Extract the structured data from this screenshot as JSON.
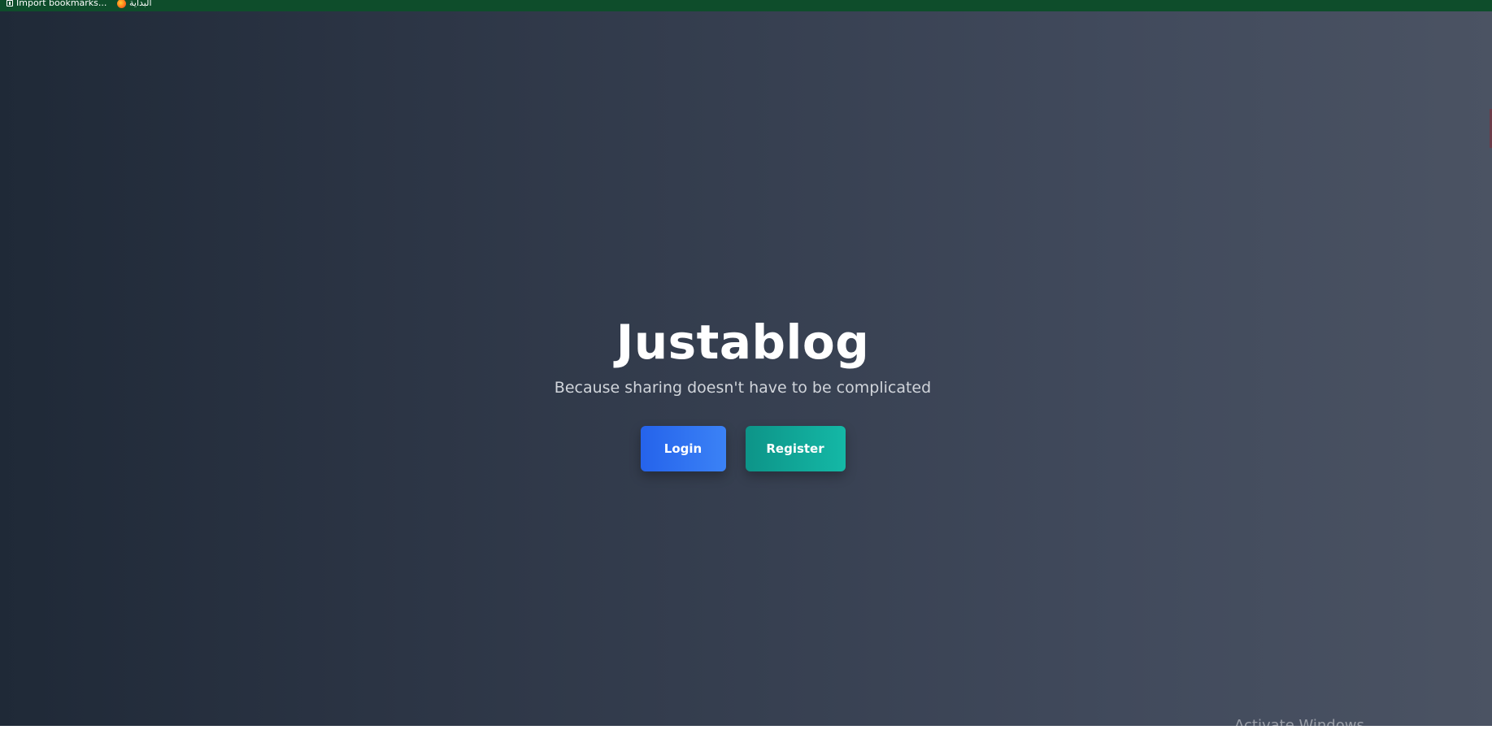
{
  "bookmarks_bar": {
    "items": [
      {
        "label": "Import bookmarks...",
        "icon": "import-bookmarks-icon"
      },
      {
        "label": "البداية",
        "icon": "firefox-icon"
      }
    ],
    "background": "#0e4d2b"
  },
  "hero": {
    "title": "Justablog",
    "subtitle": "Because sharing doesn't have to be complicated"
  },
  "actions": {
    "login_label": "Login",
    "register_label": "Register"
  },
  "colors": {
    "background_start": "#1f2937",
    "background_end": "#4b5363",
    "login_button": "#2563eb",
    "register_button": "#0d9488"
  },
  "watermark": {
    "text": "Activate Windows"
  }
}
